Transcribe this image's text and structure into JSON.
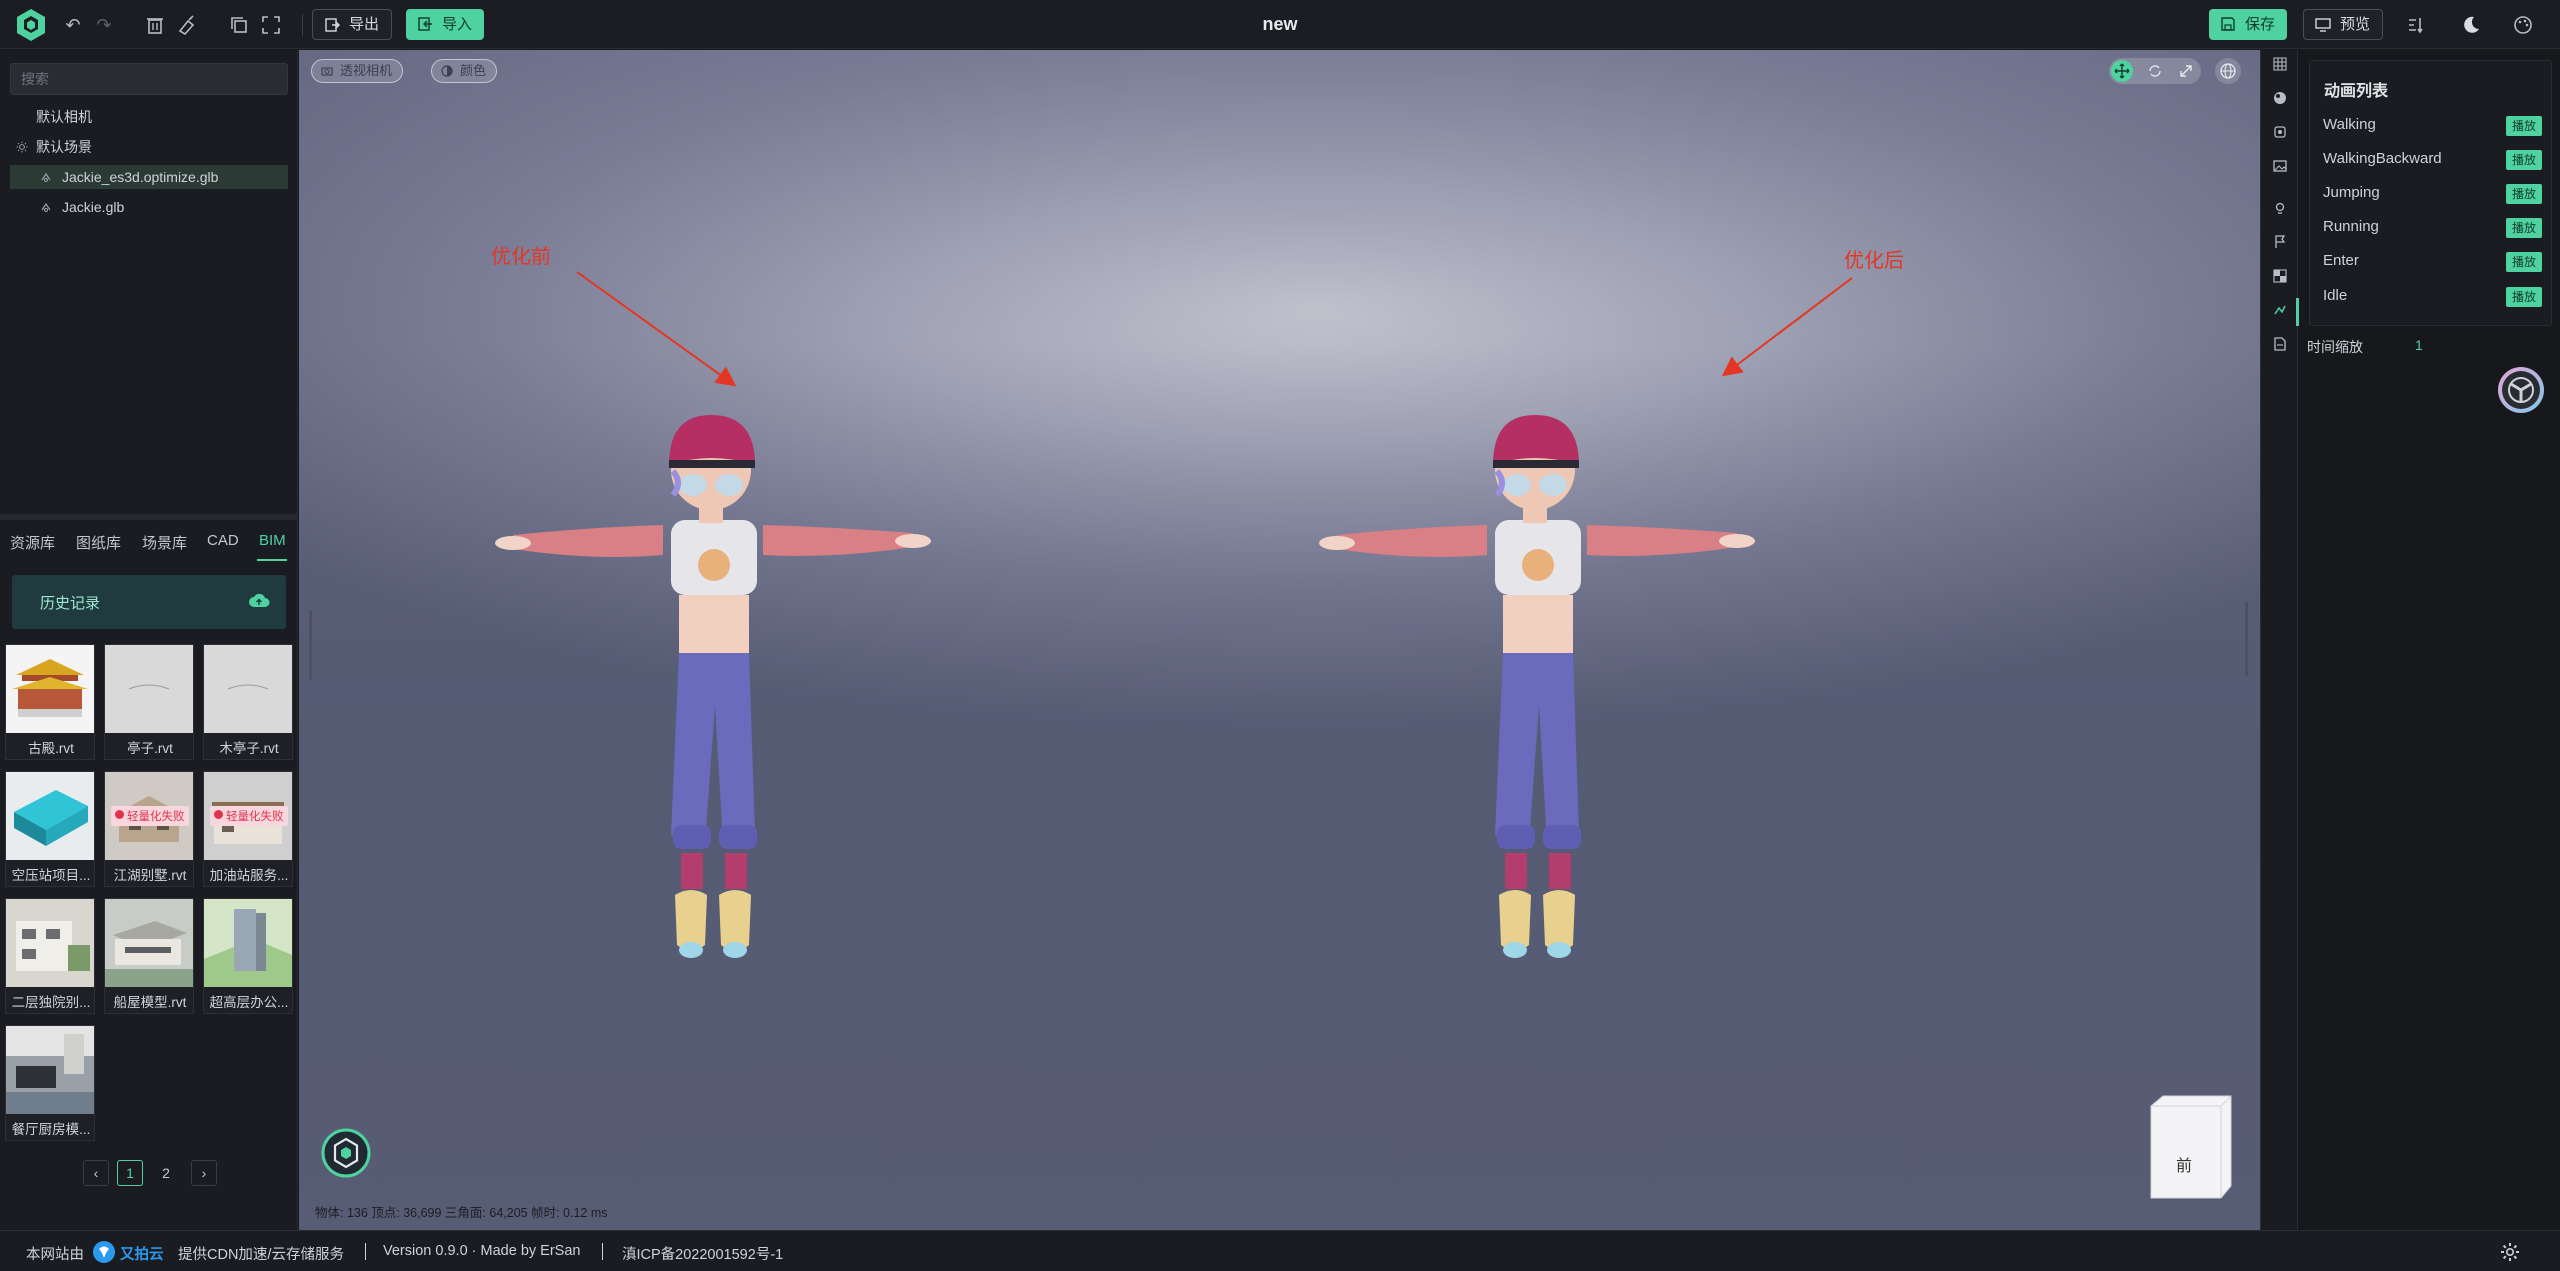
{
  "header": {
    "title": "new",
    "export_label": "导出",
    "import_label": "导入",
    "save_label": "保存",
    "preview_label": "预览"
  },
  "sidebar": {
    "search_placeholder": "搜索",
    "tree": [
      {
        "label": "默认相机"
      },
      {
        "label": "默认场景"
      },
      {
        "label": "Jackie_es3d.optimize.glb",
        "selected": true
      },
      {
        "label": "Jackie.glb"
      }
    ]
  },
  "library": {
    "tabs": [
      "资源库",
      "图纸库",
      "场景库",
      "CAD",
      "BIM"
    ],
    "active_tab": "BIM",
    "history_label": "历史记录",
    "fail_badge": "轻量化失败",
    "items": [
      {
        "label": "古殿.rvt"
      },
      {
        "label": "亭子.rvt"
      },
      {
        "label": "木亭子.rvt"
      },
      {
        "label": "空压站项目...",
        "failed": false
      },
      {
        "label": "江湖别墅.rvt",
        "failed": true
      },
      {
        "label": "加油站服务...",
        "failed": true
      },
      {
        "label": "二层独院别..."
      },
      {
        "label": "船屋模型.rvt"
      },
      {
        "label": "超高层办公..."
      },
      {
        "label": "餐厅厨房模..."
      }
    ],
    "pages": [
      "1",
      "2"
    ],
    "current_page": "1"
  },
  "viewport": {
    "camera_label": "透视相机",
    "color_label": "颜色",
    "annotation_before": "优化前",
    "annotation_after": "优化后",
    "stats": "物体: 136  顶点: 36,699  三角面: 64,205  帧时: 0.12 ms",
    "cube_face": "前"
  },
  "animation_panel": {
    "title": "动画列表",
    "play_label": "播放",
    "animations": [
      "Walking",
      "WalkingBackward",
      "Jumping",
      "Running",
      "Enter",
      "Idle"
    ],
    "time_scale_label": "时间缩放",
    "time_scale_value": "1"
  },
  "footer": {
    "host_label": "本网站由",
    "cdn_brand": "又拍云",
    "cdn_text": "提供CDN加速/云存储服务",
    "version": "Version 0.9.0 · Made by ErSan",
    "icp": "滇ICP备2022001592号-1"
  },
  "colors": {
    "accent": "#4ed3a0",
    "annotation": "#e53524",
    "panel": "#1b1c21"
  }
}
